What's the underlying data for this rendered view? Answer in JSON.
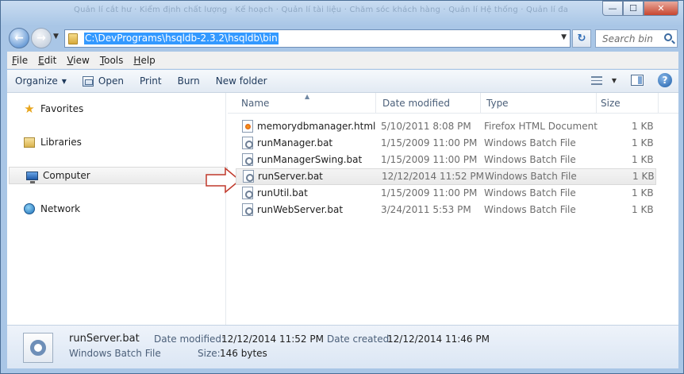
{
  "window": {
    "blurred_title": "Quản lí cắt hư · Kiểm định chất lượng · Kế hoạch · Quản lí tài liệu · Chăm sóc khách hàng · Quản lí Hệ thống · Quản lí đa",
    "minimize_glyph": "—",
    "maximize_glyph": "☐",
    "close_glyph": "✕"
  },
  "nav": {
    "back_glyph": "←",
    "forward_glyph": "→",
    "history_glyph": "▼",
    "address": "C:\\DevPrograms\\hsqldb-2.3.2\\hsqldb\\bin",
    "address_drop_glyph": "▼",
    "refresh_glyph": "↻",
    "search_placeholder": "Search bin"
  },
  "menu": {
    "items": [
      {
        "u": "F",
        "rest": "ile"
      },
      {
        "u": "E",
        "rest": "dit"
      },
      {
        "u": "V",
        "rest": "iew"
      },
      {
        "u": "T",
        "rest": "ools"
      },
      {
        "u": "H",
        "rest": "elp"
      }
    ]
  },
  "toolbar": {
    "organize": "Organize",
    "caret": "▼",
    "open": "Open",
    "print": "Print",
    "burn": "Burn",
    "new_folder": "New folder",
    "help_glyph": "?"
  },
  "sidebar": {
    "items": [
      {
        "label": "Favorites",
        "icon": "★"
      },
      {
        "label": "Libraries",
        "icon": ""
      },
      {
        "label": "Computer",
        "icon": ""
      },
      {
        "label": "Network",
        "icon": ""
      }
    ]
  },
  "columns": {
    "name": "Name",
    "date": "Date modified",
    "type": "Type",
    "size": "Size",
    "sort_glyph": "▲"
  },
  "files": [
    {
      "name": "memorydbmanager.html",
      "date": "5/10/2011 8:08 PM",
      "type": "Firefox HTML Document",
      "size": "1 KB"
    },
    {
      "name": "runManager.bat",
      "date": "1/15/2009 11:00 PM",
      "type": "Windows Batch File",
      "size": "1 KB"
    },
    {
      "name": "runManagerSwing.bat",
      "date": "1/15/2009 11:00 PM",
      "type": "Windows Batch File",
      "size": "1 KB"
    },
    {
      "name": "runServer.bat",
      "date": "12/12/2014 11:52 PM",
      "type": "Windows Batch File",
      "size": "1 KB"
    },
    {
      "name": "runUtil.bat",
      "date": "1/15/2009 11:00 PM",
      "type": "Windows Batch File",
      "size": "1 KB"
    },
    {
      "name": "runWebServer.bat",
      "date": "3/24/2011 5:53 PM",
      "type": "Windows Batch File",
      "size": "1 KB"
    }
  ],
  "details": {
    "name": "runServer.bat",
    "type": "Windows Batch File",
    "modified_label": "Date modified:",
    "modified_value": "12/12/2014 11:52 PM",
    "size_label": "Size:",
    "size_value": "146 bytes",
    "created_label": "Date created:",
    "created_value": "12/12/2014 11:46 PM"
  },
  "colors": {
    "selection": "#3399ff",
    "arrow": "#c0392b"
  }
}
